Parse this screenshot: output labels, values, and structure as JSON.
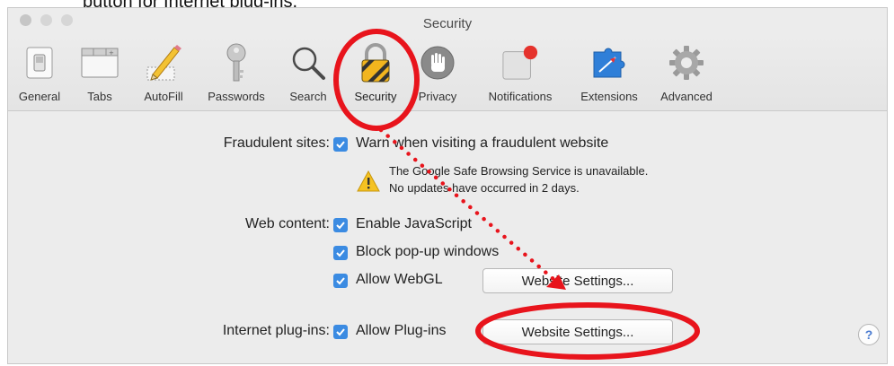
{
  "caption": "button for Internet plug-ins.",
  "window": {
    "title": "Security"
  },
  "toolbar": {
    "tabs": [
      {
        "label": "General",
        "icon": "switch-icon"
      },
      {
        "label": "Tabs",
        "icon": "tabs-icon"
      },
      {
        "label": "AutoFill",
        "icon": "pencil-icon"
      },
      {
        "label": "Passwords",
        "icon": "key-icon"
      },
      {
        "label": "Search",
        "icon": "magnifier-icon"
      },
      {
        "label": "Security",
        "icon": "padlock-icon",
        "active": true
      },
      {
        "label": "Privacy",
        "icon": "hand-icon"
      },
      {
        "label": "Notifications",
        "icon": "notification-icon"
      },
      {
        "label": "Extensions",
        "icon": "puzzle-icon"
      },
      {
        "label": "Advanced",
        "icon": "gear-icon"
      }
    ]
  },
  "settings": {
    "fraudulent": {
      "label": "Fraudulent sites:",
      "checkbox": "Warn when visiting a fraudulent website",
      "warning_line1": "The Google Safe Browsing Service is unavailable.",
      "warning_line2": "No updates have occurred in 2 days."
    },
    "web_content": {
      "label": "Web content:",
      "javascript": "Enable JavaScript",
      "popups": "Block pop-up windows",
      "webgl": "Allow WebGL",
      "webgl_button": "Website Settings..."
    },
    "plugins": {
      "label": "Internet plug-ins:",
      "checkbox": "Allow Plug-ins",
      "button": "Website Settings..."
    }
  },
  "help": "?",
  "colors": {
    "checkbox": "#3b8be2",
    "annotation": "#e8141c",
    "background": "#ececec"
  }
}
